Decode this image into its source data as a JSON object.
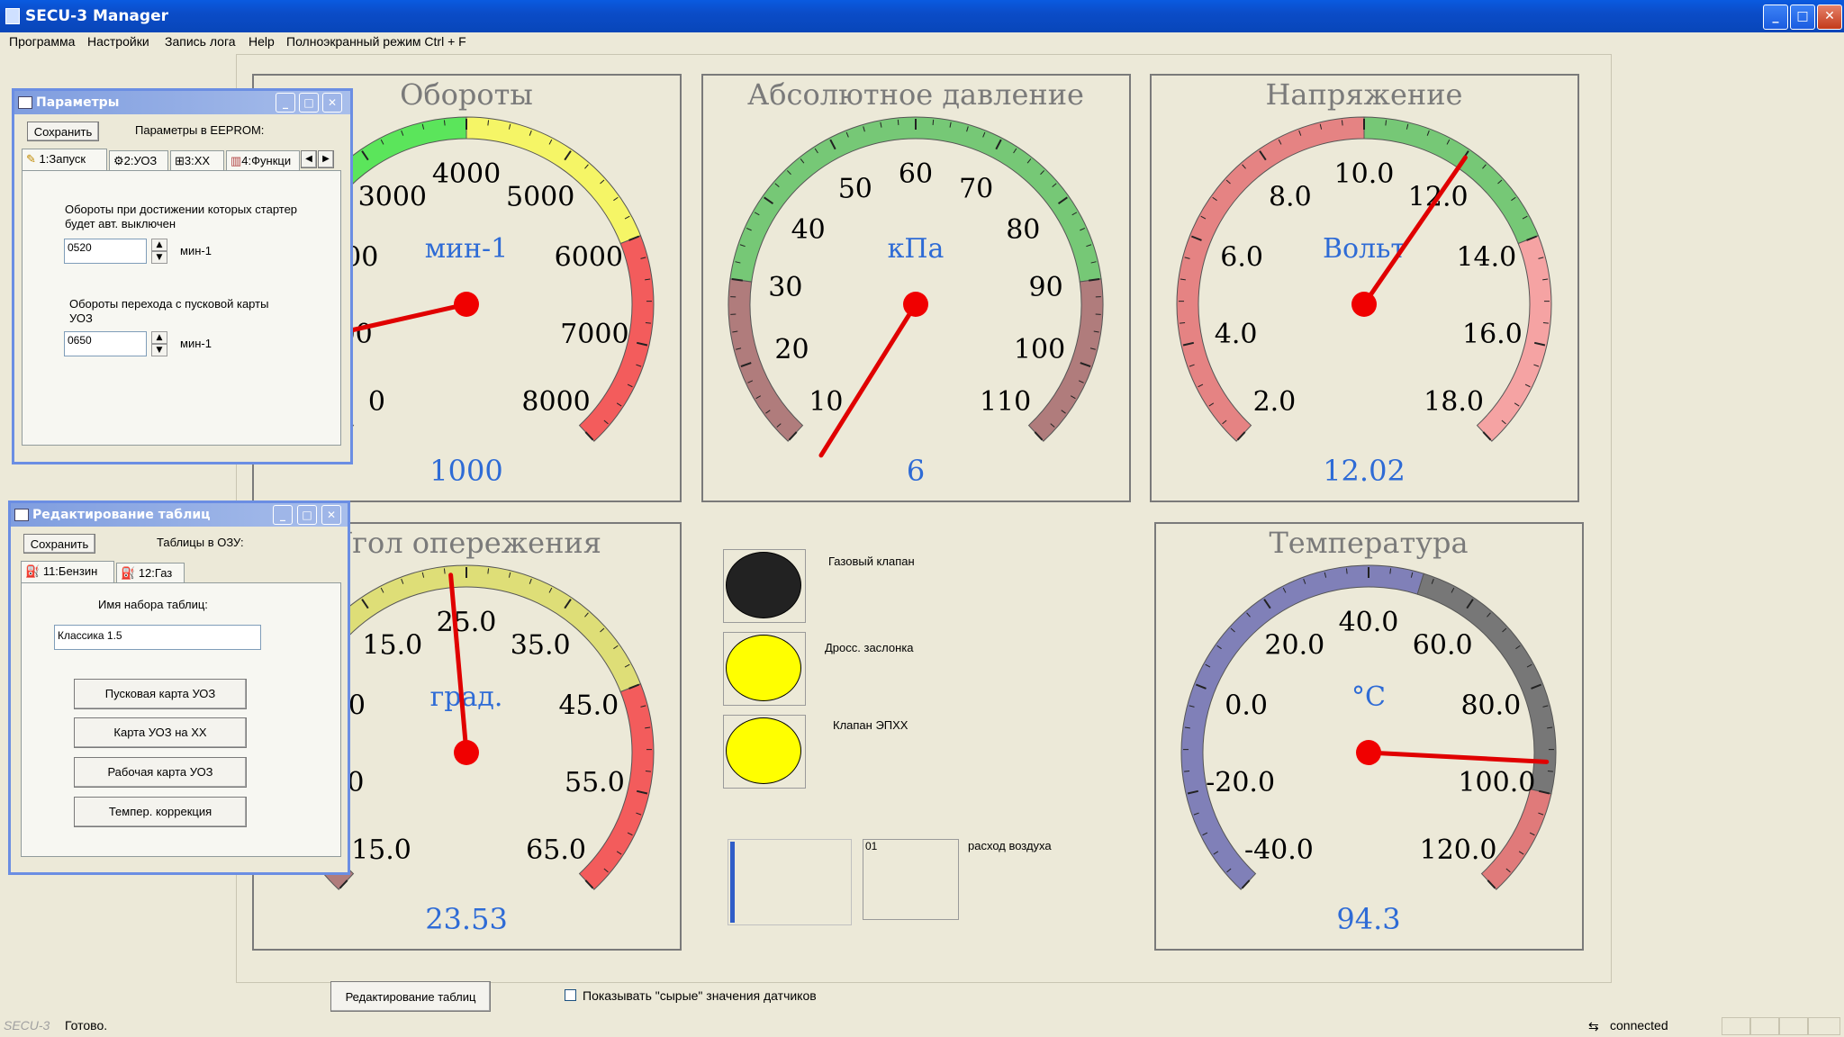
{
  "window": {
    "title": "SECU-3 Manager",
    "minimize": "_",
    "maximize": "□",
    "close": "✕"
  },
  "menu": [
    "Программа",
    "Настройки",
    "Запись лога",
    "Help",
    "Полноэкранный режим Ctrl + F"
  ],
  "gauges": {
    "rpm": {
      "title": "Обороты",
      "unit": "мин-1",
      "value": "1000",
      "ticks": [
        "0",
        "1000",
        "2000",
        "3000",
        "4000",
        "5000",
        "6000",
        "7000",
        "8000"
      ],
      "min": 0,
      "max": 8000,
      "needle": 1000,
      "bands": [
        {
          "from": 0,
          "to": 4000,
          "color": "#5BE55B"
        },
        {
          "from": 4000,
          "to": 6000,
          "color": "#F5F566"
        },
        {
          "from": 6000,
          "to": 8000,
          "color": "#F35C5C"
        }
      ]
    },
    "pressure": {
      "title": "Абсолютное давление",
      "unit": "кПа",
      "value": "6",
      "ticks": [
        "10",
        "20",
        "30",
        "40",
        "50",
        "60",
        "70",
        "80",
        "90",
        "100",
        "110"
      ],
      "min": 10,
      "max": 110,
      "needle": 6,
      "bands": [
        {
          "from": 10,
          "to": 30,
          "color": "#B07C7C"
        },
        {
          "from": 30,
          "to": 90,
          "color": "#76C876"
        },
        {
          "from": 90,
          "to": 110,
          "color": "#B07C7C"
        }
      ]
    },
    "voltage": {
      "title": "Напряжение",
      "unit": "Вольт",
      "value": "12.02",
      "ticks": [
        "2.0",
        "4.0",
        "6.0",
        "8.0",
        "10.0",
        "12.0",
        "14.0",
        "16.0",
        "18.0"
      ],
      "min": 2,
      "max": 18,
      "needle": 12.02,
      "bands": [
        {
          "from": 2,
          "to": 10,
          "color": "#E58383"
        },
        {
          "from": 10,
          "to": 14,
          "color": "#76C876"
        },
        {
          "from": 14,
          "to": 18,
          "color": "#F5A3A3"
        }
      ]
    },
    "advance": {
      "title": "Угол опережения",
      "unit": "град.",
      "value": "23.53",
      "ticks": [
        "-15.0",
        "-5.0",
        "5.0",
        "15.0",
        "25.0",
        "35.0",
        "45.0",
        "55.0",
        "65.0"
      ],
      "min": -15,
      "max": 65,
      "needle": 23.53,
      "bands": [
        {
          "from": -15,
          "to": -5,
          "color": "#B07C7C"
        },
        {
          "from": -5,
          "to": 45,
          "color": "#DEDE77"
        },
        {
          "from": 45,
          "to": 65,
          "color": "#F35C5C"
        }
      ]
    },
    "temperature": {
      "title": "Температура",
      "unit": "°C",
      "value": "94.3",
      "ticks": [
        "-40.0",
        "-20.0",
        "0.0",
        "20.0",
        "40.0",
        "60.0",
        "80.0",
        "100.0",
        "120.0"
      ],
      "min": -40,
      "max": 120,
      "needle": 94.3,
      "bands": [
        {
          "from": -40,
          "to": 50,
          "color": "#8080B8"
        },
        {
          "from": 50,
          "to": 100,
          "color": "#777777"
        },
        {
          "from": 100,
          "to": 120,
          "color": "#E07A7A"
        }
      ]
    }
  },
  "indicators": [
    {
      "label": "Газовый клапан",
      "color": "#222222"
    },
    {
      "label": "Дросс. заслонка",
      "color": "#FFFF00"
    },
    {
      "label": "Клапан ЭПХХ",
      "color": "#FFFF00"
    }
  ],
  "airflow": {
    "value": "01",
    "label": "расход воздуха",
    "fill": 0.04
  },
  "params_dialog": {
    "title": "Параметры",
    "save": "Сохранить",
    "header": "Параметры в EEPROM:",
    "tabs": [
      "1:Запуск",
      "2:УОЗ",
      "3:ХХ",
      "4:Функци"
    ],
    "field1_label": "Обороты при достижении которых стартер будет авт. выключен",
    "field1_value": "0520",
    "field1_unit": "мин-1",
    "field2_label": "Обороты перехода с пусковой карты УОЗ",
    "field2_value": "0650",
    "field2_unit": "мин-1"
  },
  "tables_dialog": {
    "title": "Редактирование таблиц",
    "save": "Сохранить",
    "header": "Таблицы в ОЗУ:",
    "tabs": [
      "11:Бензин",
      "12:Газ"
    ],
    "set_label": "Имя набора таблиц:",
    "set_value": "Классика 1.5",
    "buttons": [
      "Пусковая карта УОЗ",
      "Карта УОЗ на ХХ",
      "Рабочая карта УОЗ",
      "Темпер. коррекция"
    ]
  },
  "bottom": {
    "tab_button": "Редактирование таблиц",
    "checkbox_label": "Показывать \"сырые\" значения датчиков"
  },
  "status": {
    "brand": "SECU-3",
    "text": "Готово.",
    "connection": "connected"
  }
}
